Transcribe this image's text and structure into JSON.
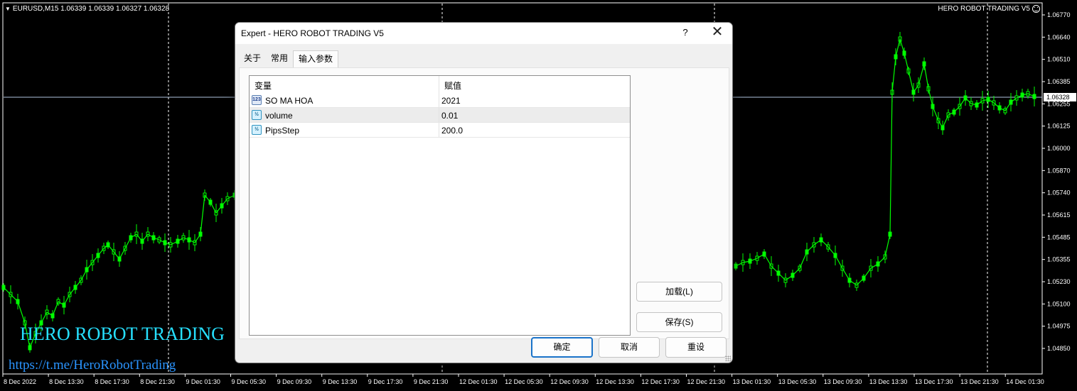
{
  "chart": {
    "symbol_info": "EURUSD,M15  1.06339 1.06339 1.06327 1.06328",
    "ea_name": "HERO ROBOT TRADING V5",
    "current_price": "1.06328",
    "watermark_title": "HERO ROBOT TRADING",
    "watermark_link": "https://t.me/HeroRobotTrading",
    "colors": {
      "background": "#000000",
      "candles": "#00ff00",
      "grid": "#ffffff",
      "price_line": "#b0c4de",
      "watermark_title": "#26e0ff",
      "watermark_link": "#2a94ff"
    },
    "price_levels": [
      "1.06770",
      "1.06640",
      "1.06510",
      "1.06385",
      "1.06255",
      "1.06125",
      "1.06000",
      "1.05870",
      "1.05740",
      "1.05615",
      "1.05485",
      "1.05355",
      "1.05230",
      "1.05100",
      "1.04975",
      "1.04850"
    ],
    "time_labels": [
      "8 Dec 2022",
      "8 Dec 13:30",
      "8 Dec 17:30",
      "8 Dec 21:30",
      "9 Dec 01:30",
      "9 Dec 05:30",
      "9 Dec 09:30",
      "9 Dec 13:30",
      "9 Dec 17:30",
      "9 Dec 21:30",
      "12 Dec 01:30",
      "12 Dec 05:30",
      "12 Dec 09:30",
      "12 Dec 13:30",
      "12 Dec 17:30",
      "12 Dec 21:30",
      "13 Dec 01:30",
      "13 Dec 05:30",
      "13 Dec 09:30",
      "13 Dec 13:30",
      "13 Dec 17:30",
      "13 Dec 21:30",
      "14 Dec 01:30"
    ]
  },
  "dialog": {
    "title": "Expert - HERO ROBOT TRADING V5",
    "help": "?",
    "close": "✕",
    "tabs": [
      {
        "label": "关于",
        "active": false
      },
      {
        "label": "常用",
        "active": false
      },
      {
        "label": "输入参数",
        "active": true
      }
    ],
    "table": {
      "headers": {
        "variable": "变量",
        "value": "赋值"
      },
      "rows": [
        {
          "icon": "integer-type-icon",
          "icon_text": "123",
          "name": "SO MA HOA",
          "value": "2021",
          "selected": false
        },
        {
          "icon": "double-type-icon",
          "icon_text": "½",
          "name": "volume",
          "value": "0.01",
          "selected": true
        },
        {
          "icon": "double-type-icon",
          "icon_text": "½",
          "name": "PipsStep",
          "value": "200.0",
          "selected": false
        }
      ]
    },
    "buttons": {
      "load": "加载(L)",
      "save": "保存(S)",
      "ok": "确定",
      "cancel": "取消",
      "reset": "重设"
    }
  }
}
